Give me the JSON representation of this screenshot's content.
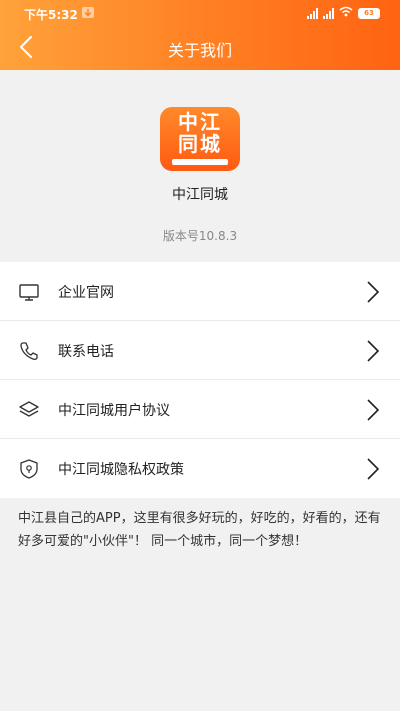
{
  "status_bar": {
    "time": "下午5:32",
    "battery": "63"
  },
  "nav": {
    "title": "关于我们"
  },
  "app": {
    "logo_text": "中江同城",
    "name": "中江同城",
    "version": "版本号10.8.3"
  },
  "menu": [
    {
      "label": "企业官网",
      "icon": "monitor-icon"
    },
    {
      "label": "联系电话",
      "icon": "phone-icon"
    },
    {
      "label": "中江同城用户协议",
      "icon": "layers-icon"
    },
    {
      "label": "中江同城隐私权政策",
      "icon": "shield-icon"
    }
  ],
  "about": {
    "text": "中江县自己的APP，这里有很多好玩的，好吃的，好看的，还有好多可爱的\"小伙伴\"！ 同一个城市，同一个梦想！"
  },
  "colors": {
    "header_start": "#ffa23a",
    "header_end": "#ff6312",
    "background": "#f1f1f1"
  }
}
